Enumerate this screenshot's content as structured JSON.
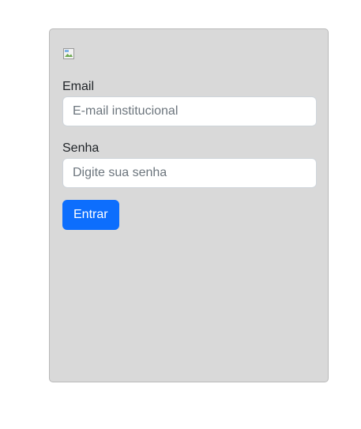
{
  "login": {
    "logo_icon": "broken-image-icon",
    "email_label": "Email",
    "email_placeholder": "E-mail institucional",
    "email_value": "",
    "password_label": "Senha",
    "password_placeholder": "Digite sua senha",
    "password_value": "",
    "submit_label": "Entrar"
  },
  "colors": {
    "card_background": "#d9d9d9",
    "button_primary": "#0d6efd"
  }
}
